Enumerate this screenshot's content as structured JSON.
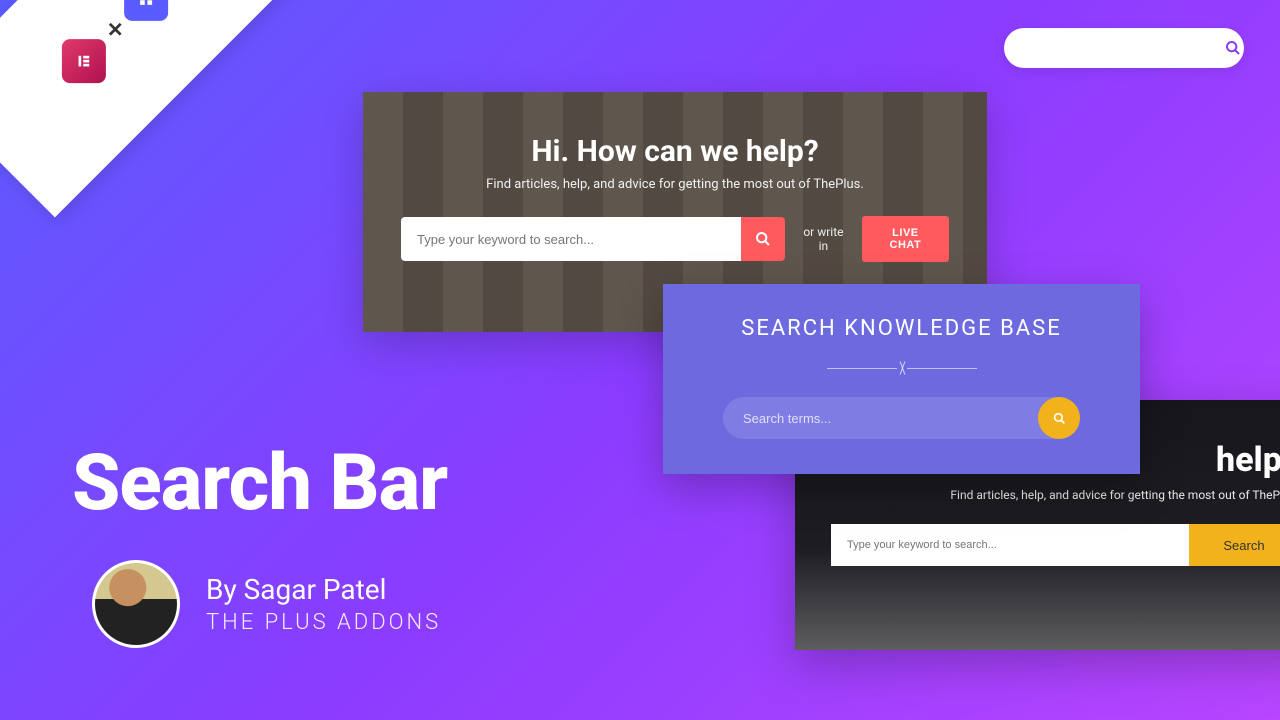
{
  "top_search": {
    "placeholder": ""
  },
  "card1": {
    "title": "Hi. How can we help?",
    "subtitle": "Find articles, help, and advice for getting the most out of ThePlus.",
    "placeholder": "Type your keyword to search...",
    "or_label": "or write in",
    "live_chat_label": "LIVE CHAT"
  },
  "card2": {
    "title": "SEARCH KNOWLEDGE BASE",
    "placeholder": "Search terms..."
  },
  "card3": {
    "title_fragment": "help?",
    "subtitle": "Find articles, help, and advice for getting the most out of ThePlus.",
    "placeholder": "Type your keyword to search...",
    "button_label": "Search"
  },
  "headline": "Search Bar",
  "byline": {
    "author": "By Sagar Patel",
    "brand": "THE PLUS ADDONS"
  },
  "ribbon": {
    "plus_symbol": "✕"
  }
}
